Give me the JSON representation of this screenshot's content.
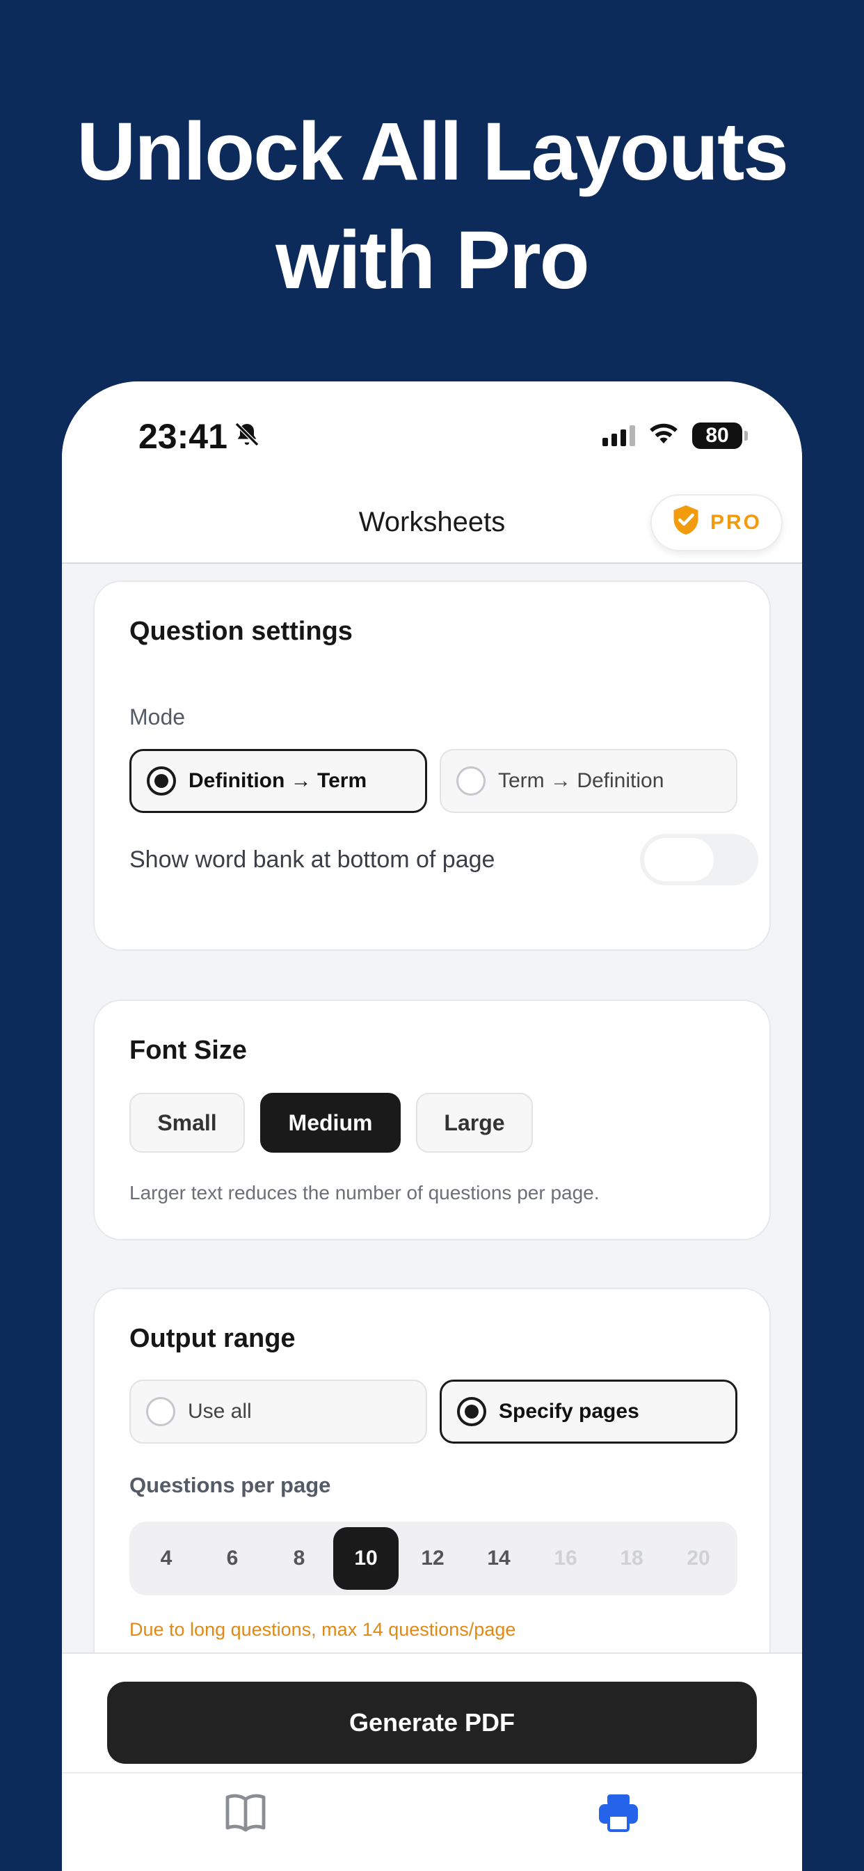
{
  "hero": {
    "line1": "Unlock All Layouts",
    "line2": "with Pro"
  },
  "status_bar": {
    "time": "23:41",
    "battery": "80",
    "icons": [
      "bell-slash-icon",
      "signal-icon",
      "wifi-icon",
      "battery-icon"
    ]
  },
  "nav": {
    "title": "Worksheets",
    "pro_label": "PRO",
    "pro_icon": "shield-check-icon"
  },
  "question_settings": {
    "title": "Question settings",
    "mode_label": "Mode",
    "modes": [
      {
        "label": "Definition → Term",
        "selected": true
      },
      {
        "label": "Term → Definition",
        "selected": false
      }
    ],
    "word_bank_label": "Show word bank at bottom of page",
    "word_bank_enabled": false
  },
  "font_size": {
    "title": "Font Size",
    "options": [
      {
        "label": "Small",
        "selected": false
      },
      {
        "label": "Medium",
        "selected": true
      },
      {
        "label": "Large",
        "selected": false
      }
    ],
    "hint": "Larger text reduces the number of questions per page."
  },
  "output_range": {
    "title": "Output range",
    "options": [
      {
        "label": "Use all",
        "selected": false
      },
      {
        "label": "Specify pages",
        "selected": true
      }
    ],
    "qpp_label": "Questions per page",
    "qpp_values": [
      {
        "label": "4",
        "state": "enabled"
      },
      {
        "label": "6",
        "state": "enabled"
      },
      {
        "label": "8",
        "state": "enabled"
      },
      {
        "label": "10",
        "state": "selected"
      },
      {
        "label": "12",
        "state": "enabled"
      },
      {
        "label": "14",
        "state": "enabled"
      },
      {
        "label": "16",
        "state": "disabled"
      },
      {
        "label": "18",
        "state": "disabled"
      },
      {
        "label": "20",
        "state": "disabled"
      }
    ],
    "warning": "Due to long questions, max 14 questions/page"
  },
  "actions": {
    "generate_label": "Generate PDF"
  },
  "tabs": {
    "icons": [
      "book-icon",
      "printer-icon"
    ]
  },
  "colors": {
    "background": "#0c2a5a",
    "accent_pro": "#f29b0d",
    "warning": "#e08a15",
    "tab_active": "#2563eb"
  }
}
